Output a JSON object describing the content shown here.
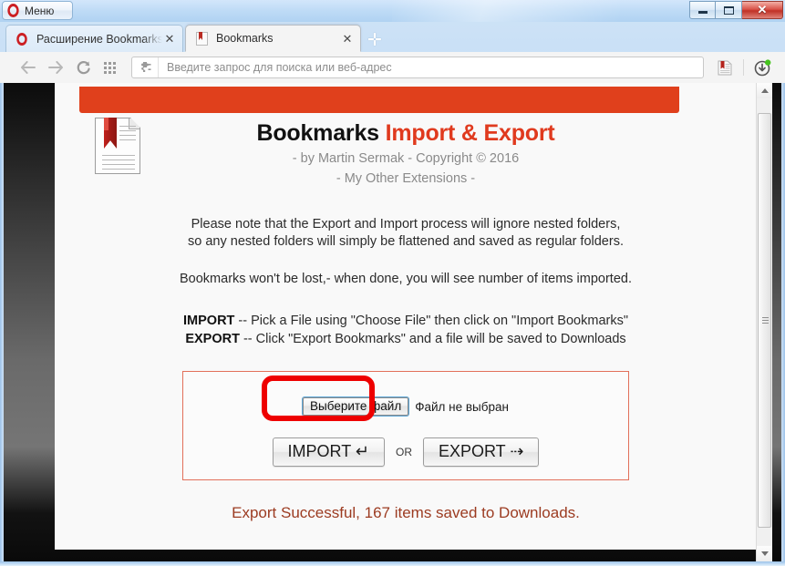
{
  "window": {
    "menu_button_label": "Меню",
    "controls": {
      "minimize": "minimize",
      "maximize": "restore",
      "close": "✕"
    }
  },
  "tabs": [
    {
      "title": "Расширение Bookmarks I",
      "favicon": "opera-icon",
      "active": false,
      "close_label": "✕"
    },
    {
      "title": "Bookmarks",
      "favicon": "bookmark-document-icon",
      "active": true,
      "close_label": "✕"
    }
  ],
  "new_tab_label": "✛",
  "toolbar": {
    "back": "back-arrow-icon",
    "forward": "forward-arrow-icon",
    "reload": "reload-icon",
    "speeddial": "speed-dial-grid-icon",
    "address": {
      "placeholder": "Введите запрос для поиска или веб-адрес",
      "value": "",
      "leading_icon": "extension-puzzle-icon"
    },
    "extension_icon": "bookmarks-extension-icon",
    "downloads_icon": "downloads-icon"
  },
  "page": {
    "banner_color": "#e0401c",
    "logo_icon": "bookmark-document-icon",
    "title_plain": "Bookmarks ",
    "title_accent": "Import & Export",
    "byline": "- by Martin Sermak - Copyright © 2016",
    "other_extensions": "- My Other Extensions -",
    "note_line1": "Please note that the Export and Import process will ignore nested folders,",
    "note_line2": "so any nested folders will simply be flattened and saved as regular folders.",
    "note_line3": "Bookmarks won't be lost,- when done, you will see number of items imported.",
    "import_instr_label": "IMPORT",
    "import_instr_text": " -- Pick a File using \"Choose File\" then click on \"Import Bookmarks\"",
    "export_instr_label": "EXPORT",
    "export_instr_text": " -- Click \"Export Bookmarks\" and a file will be saved to Downloads",
    "file_input": {
      "button_label": "Выберите файл",
      "status_text": "Файл не выбран",
      "highlight_color": "#ee0000"
    },
    "import_button": "IMPORT ↵",
    "or_label": "OR",
    "export_button": "EXPORT ⇢",
    "status_message": "Export Successful, 167 items saved to Downloads.",
    "status_color": "#9c3b21",
    "items_saved": 167
  },
  "scrollbar": {
    "up_arrow": "scroll-up-arrow",
    "down_arrow": "scroll-down-arrow"
  }
}
